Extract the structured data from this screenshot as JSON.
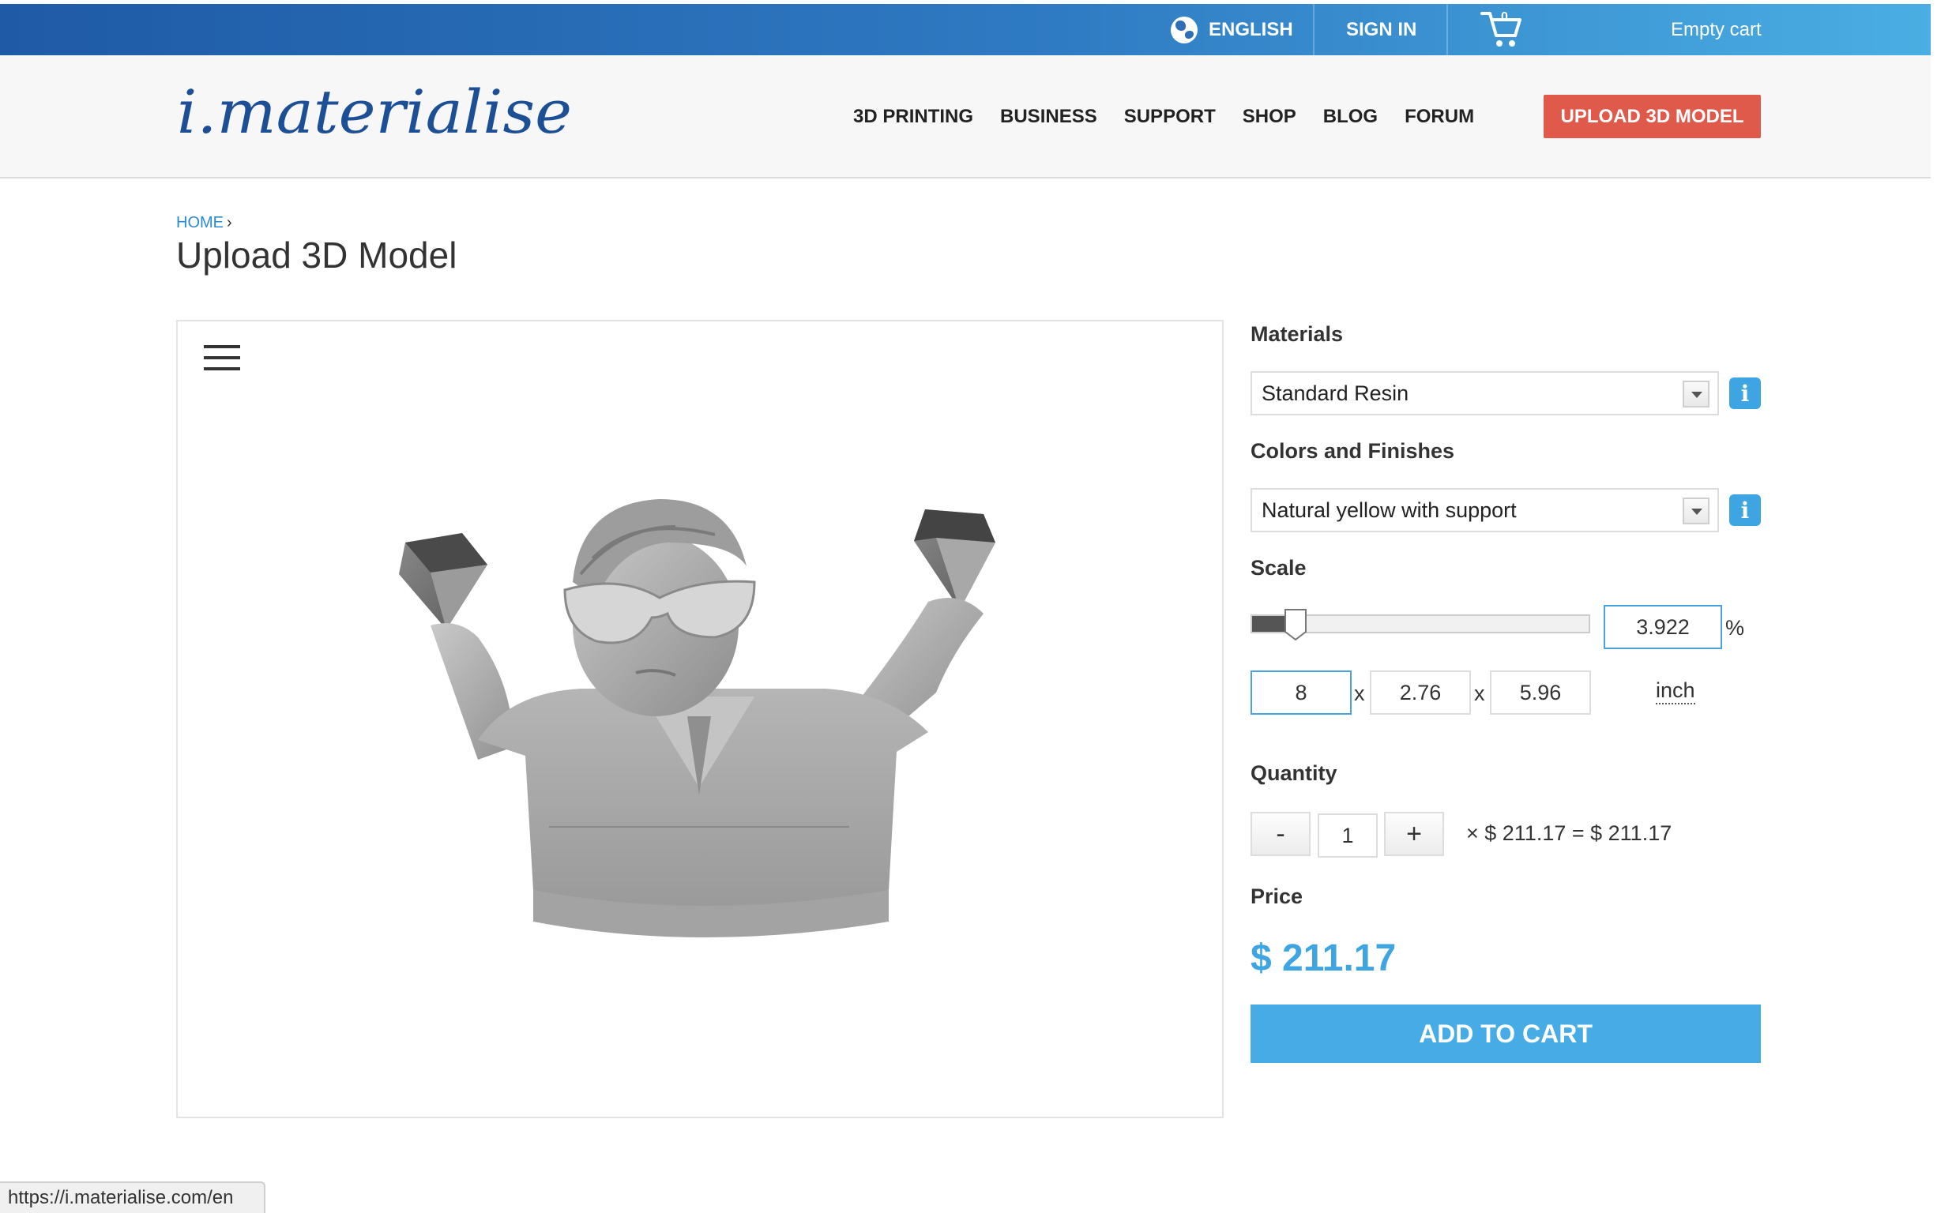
{
  "topbar": {
    "language": "ENGLISH",
    "sign_in": "SIGN IN",
    "cart_count": "0",
    "cart_status": "Empty cart"
  },
  "header": {
    "logo_text": "i.materialise",
    "nav": [
      "3D PRINTING",
      "BUSINESS",
      "SUPPORT",
      "SHOP",
      "BLOG",
      "FORUM"
    ],
    "upload_button": "UPLOAD 3D MODEL"
  },
  "breadcrumb": {
    "home": "HOME",
    "separator": "›"
  },
  "page_title": "Upload 3D Model",
  "viewer": {
    "menu_icon": "hamburger-menu-icon",
    "model_icon": "3d-model-figure"
  },
  "config": {
    "materials_label": "Materials",
    "material_value": "Standard Resin",
    "colors_label": "Colors and Finishes",
    "color_value": "Natural yellow with support",
    "info_glyph": "i",
    "scale_label": "Scale",
    "scale_percent": "3.922",
    "scale_fraction": 0.13,
    "percent_symbol": "%",
    "dim_x": "8",
    "dim_y": "2.76",
    "dim_z": "5.96",
    "dim_separator": "x",
    "unit": "inch",
    "quantity_label": "Quantity",
    "qty_minus": "-",
    "qty_value": "1",
    "qty_plus": "+",
    "qty_formula": "× $ 211.17 = $ 211.17",
    "price_label": "Price",
    "price_value": "$ 211.17",
    "add_to_cart": "ADD TO CART"
  },
  "status_bar": {
    "url": "https://i.materialise.com/en"
  },
  "colors": {
    "topbar_start": "#1f5aa6",
    "topbar_end": "#4aaee3",
    "upload_button": "#e05a4c",
    "accent_blue": "#3ea4e2"
  }
}
